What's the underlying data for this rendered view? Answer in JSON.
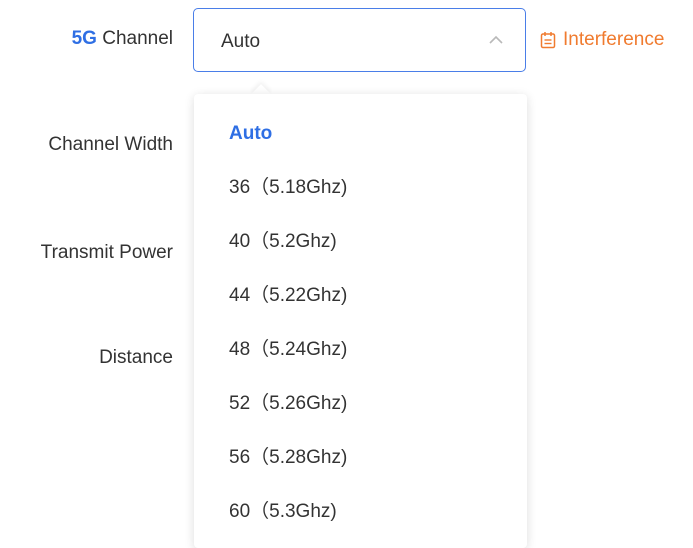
{
  "form": {
    "channel_label_prefix": "5G",
    "channel_label_suffix": " Channel",
    "channel_width_label": "Channel Width",
    "transmit_power_label": "Transmit Power",
    "distance_label": "Distance"
  },
  "channel_select": {
    "value": "Auto",
    "state": "expanded",
    "border_color": "#4a7ee8"
  },
  "interference_link": {
    "label": "Interference",
    "icon": "calendar-icon",
    "color": "#f07b2f"
  },
  "dropdown": {
    "selected": "Auto",
    "accent_color": "#2f6fe4",
    "options": [
      "Auto",
      "36（5.18Ghz)",
      "40（5.2Ghz)",
      "44（5.22Ghz)",
      "48（5.24Ghz)",
      "52（5.26Ghz)",
      "56（5.28Ghz)",
      "60（5.3Ghz)"
    ]
  }
}
